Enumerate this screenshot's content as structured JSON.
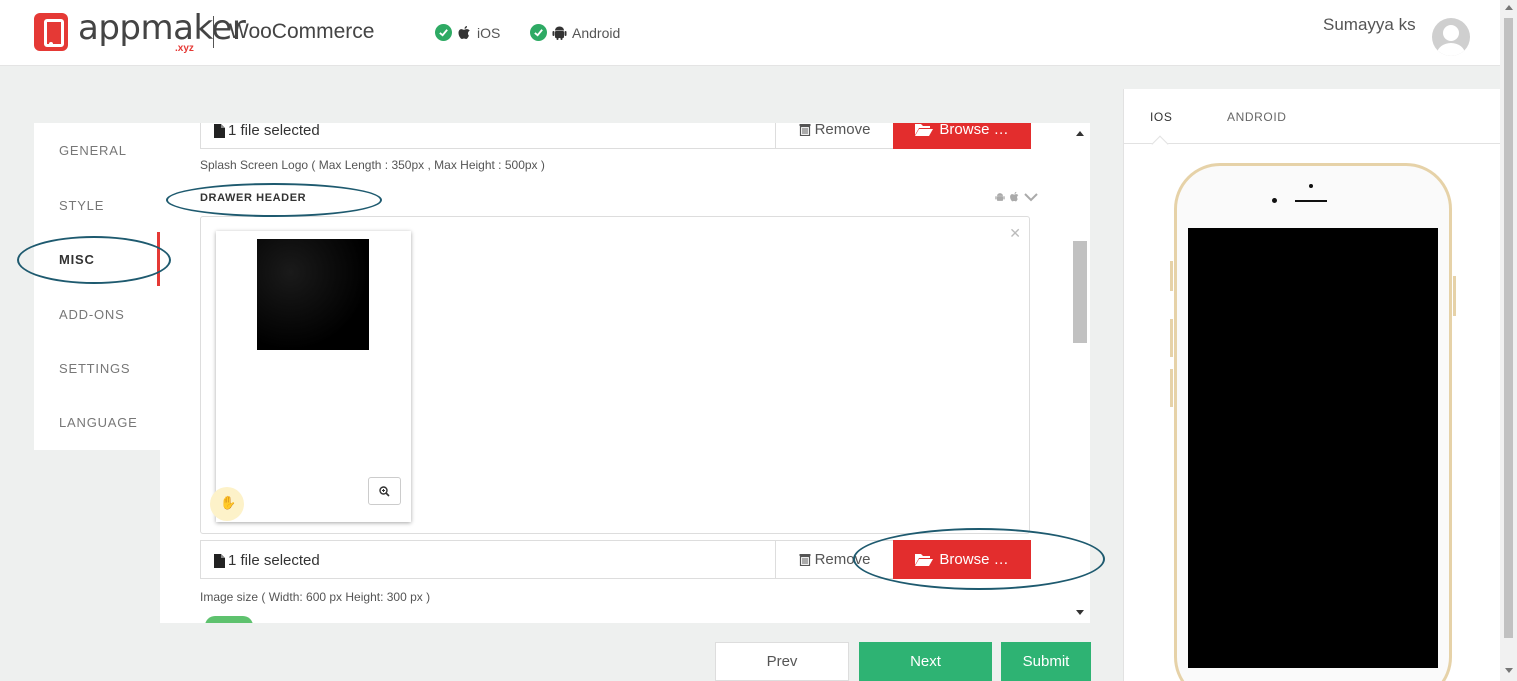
{
  "header": {
    "logo_text": "appmaker",
    "logo_sub": ".xyz",
    "platform": "WooCommerce",
    "platforms": [
      {
        "label": "iOS",
        "status_color": "#2eaa64"
      },
      {
        "label": "Android",
        "status_color": "#2eaa64"
      }
    ],
    "user_name": "Sumayya ks"
  },
  "sidebar": {
    "items": [
      {
        "label": "GENERAL"
      },
      {
        "label": "STYLE"
      },
      {
        "label": "MISC",
        "active": true
      },
      {
        "label": "ADD-ONS"
      },
      {
        "label": "SETTINGS"
      },
      {
        "label": "LANGUAGE"
      }
    ]
  },
  "splash": {
    "file_text": "1 file selected",
    "remove_label": "Remove",
    "browse_label": "Browse …",
    "hint": "Splash Screen Logo ( Max Length : 350px , Max Height : 500px )"
  },
  "drawer": {
    "title": "DRAWER HEADER",
    "file_text": "1 file selected",
    "remove_label": "Remove",
    "browse_label": "Browse …",
    "hint": "Image size ( Width: 600 px Height: 300 px )"
  },
  "footer": {
    "prev_label": "Prev",
    "next_label": "Next",
    "submit_label": "Submit"
  },
  "preview": {
    "tabs": [
      {
        "label": "IOS",
        "active": true
      },
      {
        "label": "ANDROID"
      }
    ]
  },
  "colors": {
    "accent_red": "#e32d2d",
    "accent_green": "#2eb373",
    "annotation": "#1e5a6f"
  }
}
